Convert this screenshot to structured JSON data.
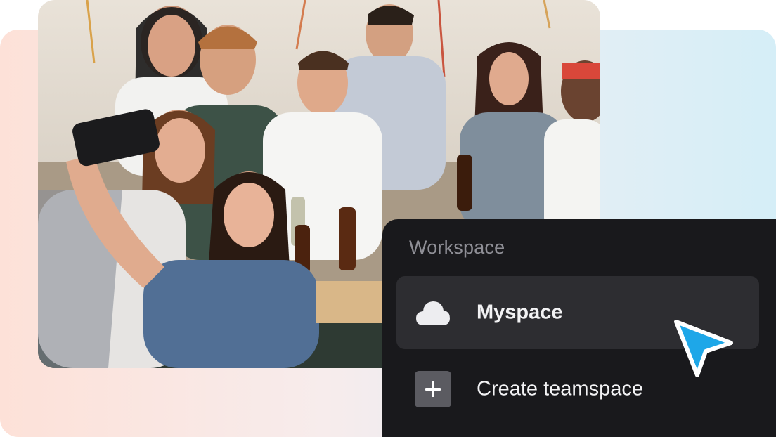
{
  "photo": {
    "description_alt": "Group of friends taking a selfie"
  },
  "workspace_menu": {
    "title": "Workspace",
    "items": [
      {
        "label": "Myspace",
        "icon": "cloud-icon",
        "active": true
      },
      {
        "label": "Create teamspace",
        "icon": "plus-icon",
        "active": false
      }
    ]
  },
  "colors": {
    "panel_bg": "#19191c",
    "active_item_bg": "#2d2d31",
    "cursor": "#1ea7e8"
  }
}
